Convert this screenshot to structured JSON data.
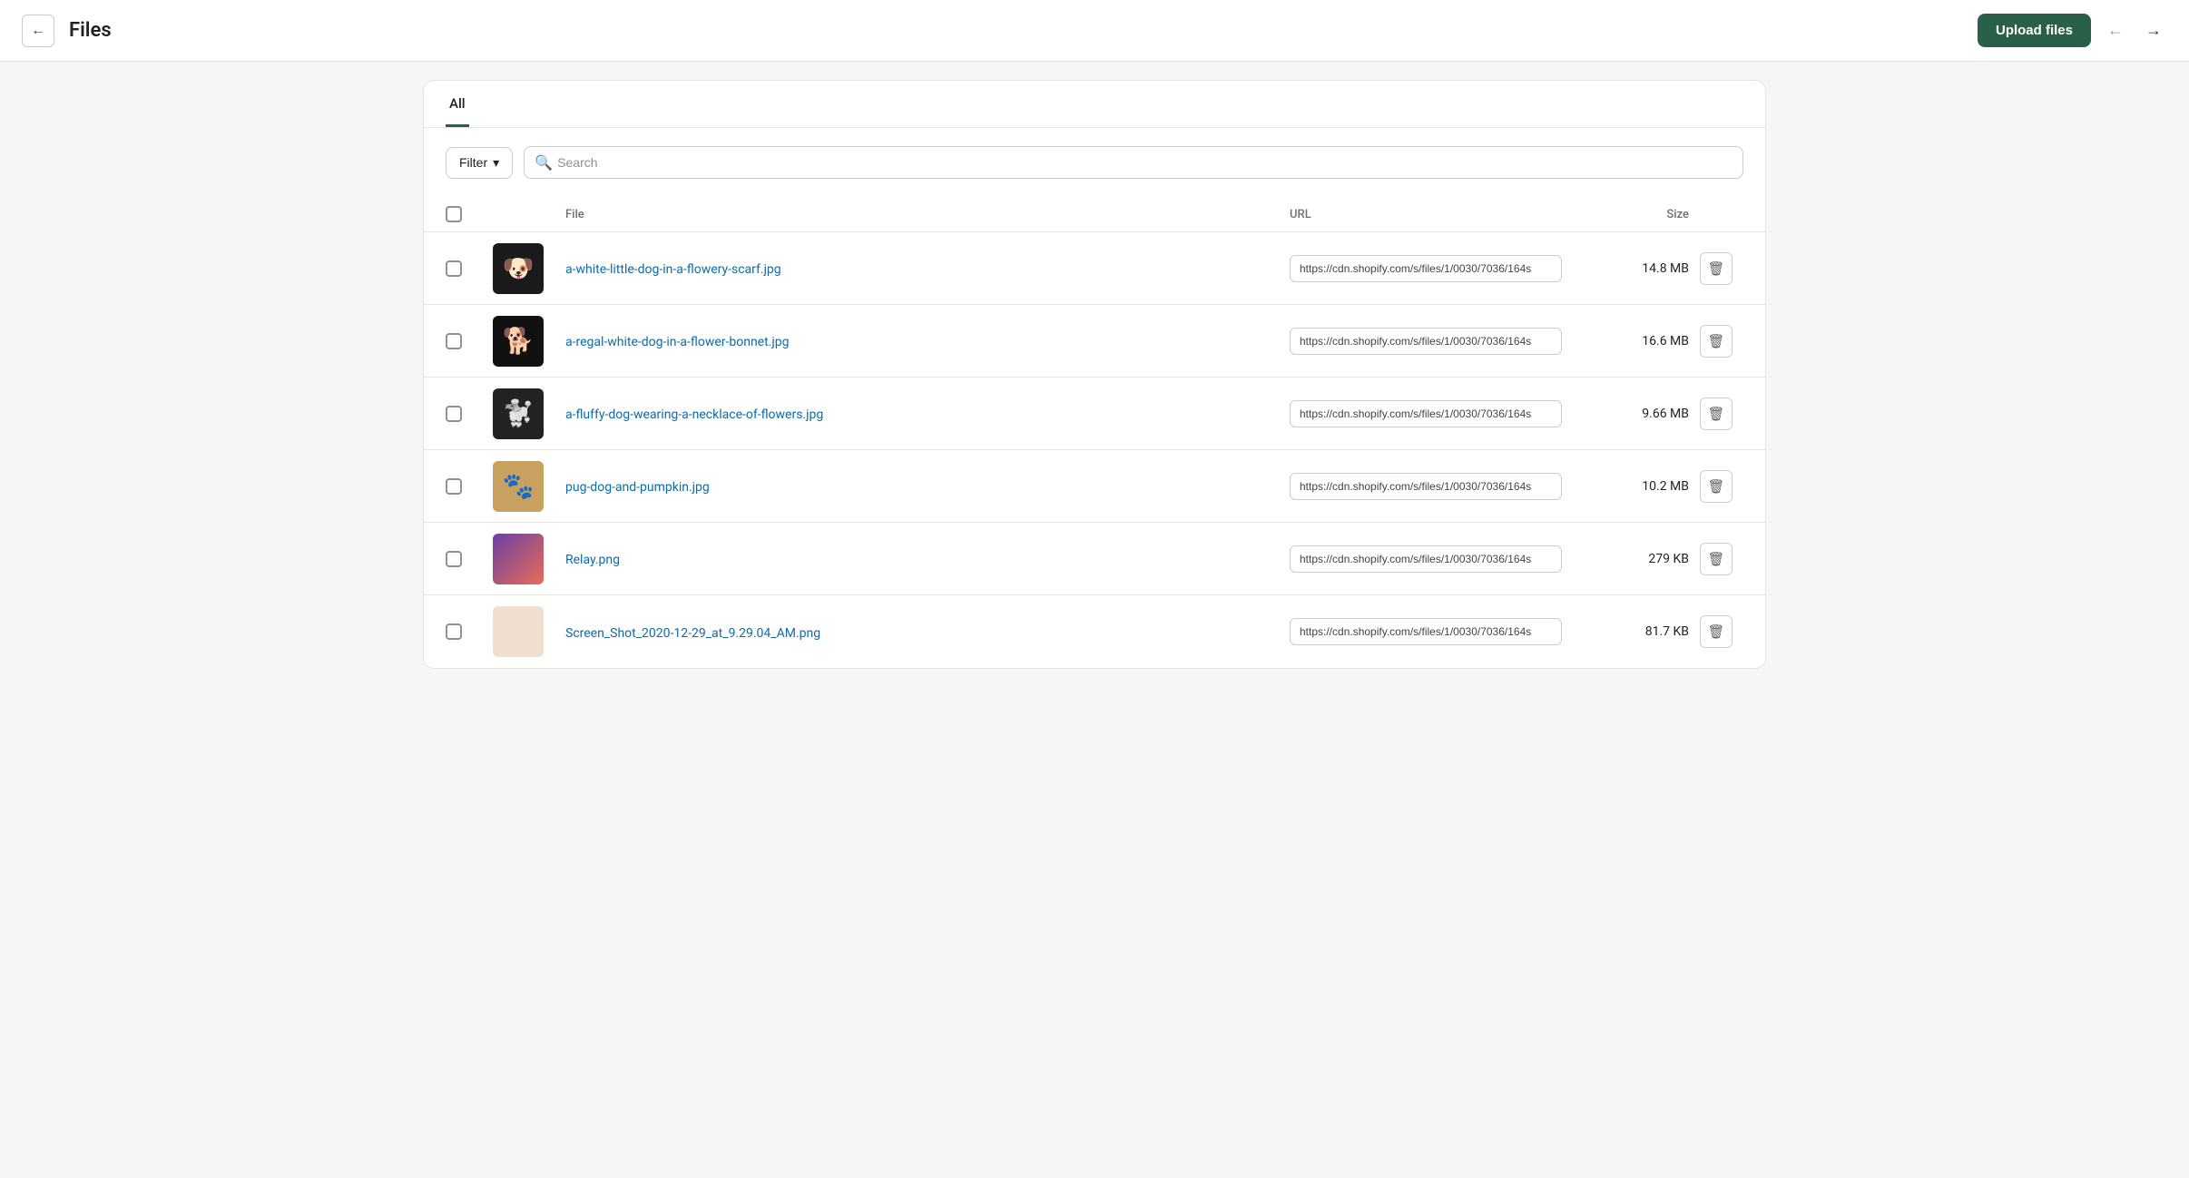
{
  "header": {
    "back_label": "←",
    "title": "Files",
    "upload_label": "Upload files",
    "nav_back": "←",
    "nav_forward": "→"
  },
  "tabs": [
    {
      "id": "all",
      "label": "All",
      "active": true
    }
  ],
  "toolbar": {
    "filter_label": "Filter",
    "filter_icon": "▾",
    "search_placeholder": "Search"
  },
  "table": {
    "columns": {
      "file": "File",
      "url": "URL",
      "size": "Size"
    },
    "rows": [
      {
        "id": "row1",
        "name": "a-white-little-dog-in-a-flowery-scarf.jpg",
        "url": "https://cdn.shopify.com/s/files/1/0030/7036/164s",
        "size": "14.8 MB",
        "thumb_class": "thumb-dog1",
        "thumb_emoji": "🐶"
      },
      {
        "id": "row2",
        "name": "a-regal-white-dog-in-a-flower-bonnet.jpg",
        "url": "https://cdn.shopify.com/s/files/1/0030/7036/164s",
        "size": "16.6 MB",
        "thumb_class": "thumb-dog2",
        "thumb_emoji": "🐕"
      },
      {
        "id": "row3",
        "name": "a-fluffy-dog-wearing-a-necklace-of-flowers.jpg",
        "url": "https://cdn.shopify.com/s/files/1/0030/7036/164s",
        "size": "9.66 MB",
        "thumb_class": "thumb-dog3",
        "thumb_emoji": "🐩"
      },
      {
        "id": "row4",
        "name": "pug-dog-and-pumpkin.jpg",
        "url": "https://cdn.shopify.com/s/files/1/0030/7036/164s",
        "size": "10.2 MB",
        "thumb_class": "thumb-dog4",
        "thumb_emoji": "🐾"
      },
      {
        "id": "row5",
        "name": "Relay.png",
        "url": "https://cdn.shopify.com/s/files/1/0030/7036/164s",
        "size": "279 KB",
        "thumb_class": "thumb-relay",
        "thumb_emoji": ""
      },
      {
        "id": "row6",
        "name": "Screen_Shot_2020-12-29_at_9.29.04_AM.png",
        "url": "https://cdn.shopify.com/s/files/1/0030/7036/164s",
        "size": "81.7 KB",
        "thumb_class": "thumb-screenshot",
        "thumb_emoji": ""
      }
    ]
  }
}
